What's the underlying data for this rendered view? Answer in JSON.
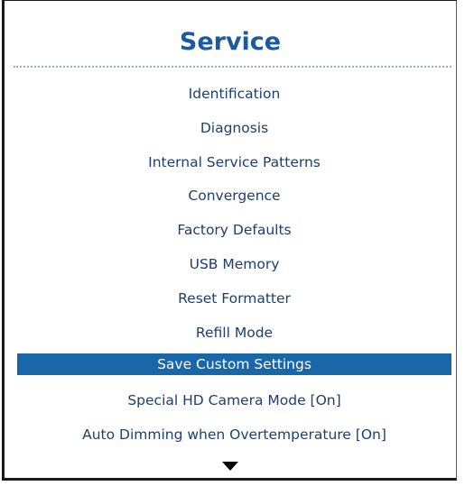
{
  "panel": {
    "title": "Service",
    "items": [
      {
        "label": "Identification",
        "selected": false
      },
      {
        "label": "Diagnosis",
        "selected": false
      },
      {
        "label": "Internal Service Patterns",
        "selected": false
      },
      {
        "label": "Convergence",
        "selected": false
      },
      {
        "label": "Factory Defaults",
        "selected": false
      },
      {
        "label": "USB Memory",
        "selected": false
      },
      {
        "label": "Reset Formatter",
        "selected": false
      },
      {
        "label": "Refill Mode",
        "selected": false
      },
      {
        "label": "Save Custom Settings",
        "selected": true
      },
      {
        "label": "Special HD Camera Mode [On]",
        "selected": false
      },
      {
        "label": "Auto Dimming when Overtemperature [On]",
        "selected": false
      }
    ],
    "scroll_indicator": "chevron-down-icon"
  },
  "colors": {
    "title": "#1b5aa0",
    "item_text": "#1c3f72",
    "selection_bg": "#1966a9",
    "selection_text": "#ffffff"
  }
}
